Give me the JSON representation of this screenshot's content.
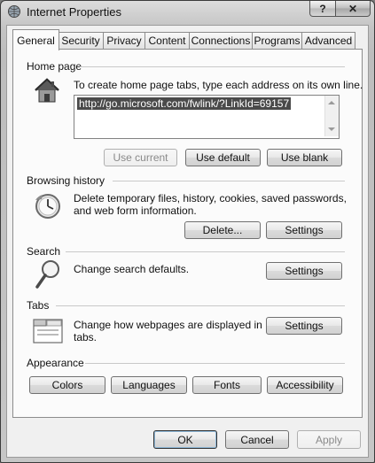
{
  "window": {
    "title": "Internet Properties",
    "help_label": "?",
    "close_label": "✕"
  },
  "tabs": [
    {
      "label": "General"
    },
    {
      "label": "Security"
    },
    {
      "label": "Privacy"
    },
    {
      "label": "Content"
    },
    {
      "label": "Connections"
    },
    {
      "label": "Programs"
    },
    {
      "label": "Advanced"
    }
  ],
  "home_page": {
    "title": "Home page",
    "description": "To create home page tabs, type each address on its own line.",
    "url": "http://go.microsoft.com/fwlink/?LinkId=69157",
    "use_current": "Use current",
    "use_default": "Use default",
    "use_blank": "Use blank"
  },
  "browsing_history": {
    "title": "Browsing history",
    "line1": "Delete temporary files, history, cookies, saved passwords,",
    "line2": "and web form information.",
    "delete": "Delete...",
    "settings": "Settings"
  },
  "search": {
    "title": "Search",
    "description": "Change search defaults.",
    "settings": "Settings"
  },
  "tabs_group": {
    "title": "Tabs",
    "line1": "Change how webpages are displayed in",
    "line2": "tabs.",
    "settings": "Settings"
  },
  "appearance": {
    "title": "Appearance",
    "colors": "Colors",
    "languages": "Languages",
    "fonts": "Fonts",
    "accessibility": "Accessibility"
  },
  "footer": {
    "ok": "OK",
    "cancel": "Cancel",
    "apply": "Apply"
  },
  "icons": {
    "title": "globe-icon",
    "home": "house-icon",
    "history": "clock-icon",
    "search": "magnifier-icon",
    "tabs": "tabs-icon"
  }
}
